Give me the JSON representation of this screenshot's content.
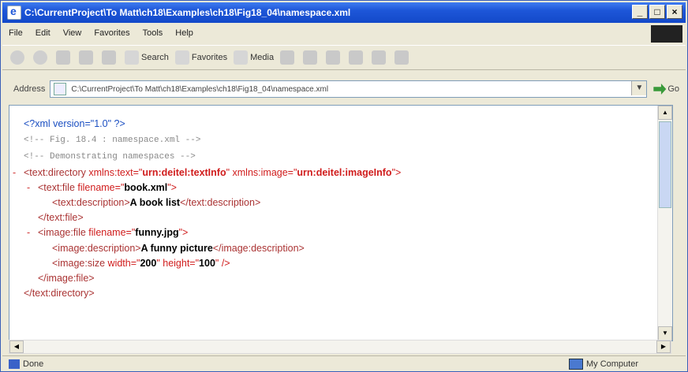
{
  "window": {
    "title": "C:\\CurrentProject\\To Matt\\ch18\\Examples\\ch18\\Fig18_04\\namespace.xml"
  },
  "menu": [
    "File",
    "Edit",
    "View",
    "Favorites",
    "Tools",
    "Help"
  ],
  "toolbar": {
    "search_label": "Search",
    "favorites_label": "Favorites",
    "media_label": "Media"
  },
  "address": {
    "label": "Address",
    "value": "C:\\CurrentProject\\To Matt\\ch18\\Examples\\ch18\\Fig18_04\\namespace.xml",
    "go_label": "Go"
  },
  "xml": {
    "decl": "<?xml version=\"1.0\" ?>",
    "comment1": "<!--  Fig. 18.4 : namespace.xml   -->",
    "comment2": "<!--  Demonstrating namespaces     -->",
    "root_minus": "-",
    "root_open": "<text:directory",
    "ns_text_attr": "xmlns:text=\"",
    "ns_text_val": "urn:deitel:textInfo",
    "ns_text_close": "\"",
    "ns_image_attr": "xmlns:image=\"",
    "ns_image_val": "urn:deitel:imageInfo",
    "ns_image_close": "\">",
    "tf_minus": "-",
    "tf_open": "<text:file",
    "tf_attr": "filename=\"",
    "tf_val": "book.xml",
    "tf_close": "\">",
    "td_open": "<text:description>",
    "td_text": "A book list",
    "td_close": "</text:description>",
    "tf_end": "</text:file>",
    "if_minus": "-",
    "if_open": "<image:file",
    "if_attr": "filename=\"",
    "if_val": "funny.jpg",
    "if_close": "\">",
    "id_open": "<image:description>",
    "id_text": "A funny picture",
    "id_close": "</image:description>",
    "is_open": "<image:size",
    "is_w_attr": "width=\"",
    "is_w_val": "200",
    "is_h_attr": "\" height=\"",
    "is_h_val": "100",
    "is_close": "\" />",
    "if_end": "</image:file>",
    "root_end": "</text:directory>"
  },
  "status": {
    "text": "Done",
    "zone": "My Computer"
  }
}
